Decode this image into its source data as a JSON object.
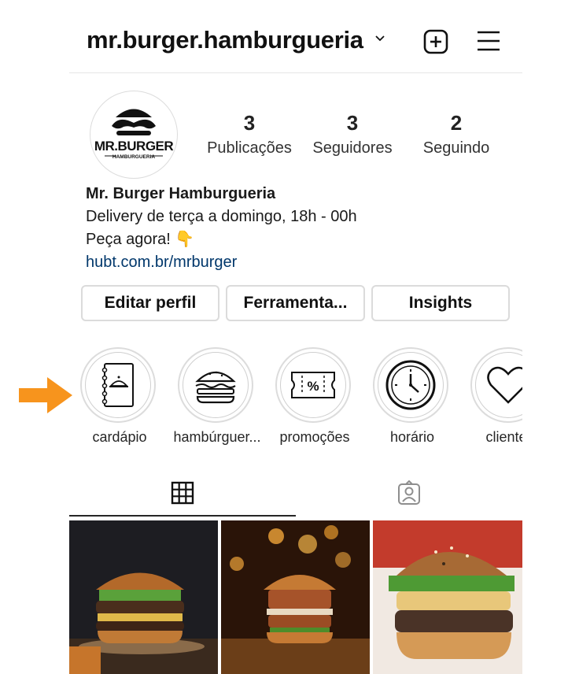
{
  "header": {
    "username": "mr.burger.hamburgueria"
  },
  "profile": {
    "logo_text": "MR.BURGER",
    "logo_subtext": "HAMBURGUERIA",
    "stats": [
      {
        "value": "3",
        "label": "Publicações"
      },
      {
        "value": "3",
        "label": "Seguidores"
      },
      {
        "value": "2",
        "label": "Seguindo"
      }
    ],
    "bio": {
      "name": "Mr. Burger Hamburgueria",
      "line1": "Delivery de terça a domingo, 18h - 00h",
      "line2": "Peça agora! 👇",
      "link": "hubt.com.br/mrburger"
    }
  },
  "buttons": {
    "edit_profile": "Editar perfil",
    "tools": "Ferramenta...",
    "insights": "Insights"
  },
  "highlights": [
    {
      "label": "cardápio",
      "icon": "menu-book-icon"
    },
    {
      "label": "hambúrguer...",
      "icon": "burger-icon"
    },
    {
      "label": "promoções",
      "icon": "coupon-icon"
    },
    {
      "label": "horário",
      "icon": "clock-icon"
    },
    {
      "label": "clientes",
      "icon": "heart-icon"
    }
  ],
  "tabs": [
    {
      "name": "grid",
      "icon": "grid-icon"
    },
    {
      "name": "tagged",
      "icon": "tagged-person-icon"
    }
  ],
  "colors": {
    "accent_arrow": "#f7941d",
    "link": "#00376b",
    "active_tab": "#262626"
  }
}
